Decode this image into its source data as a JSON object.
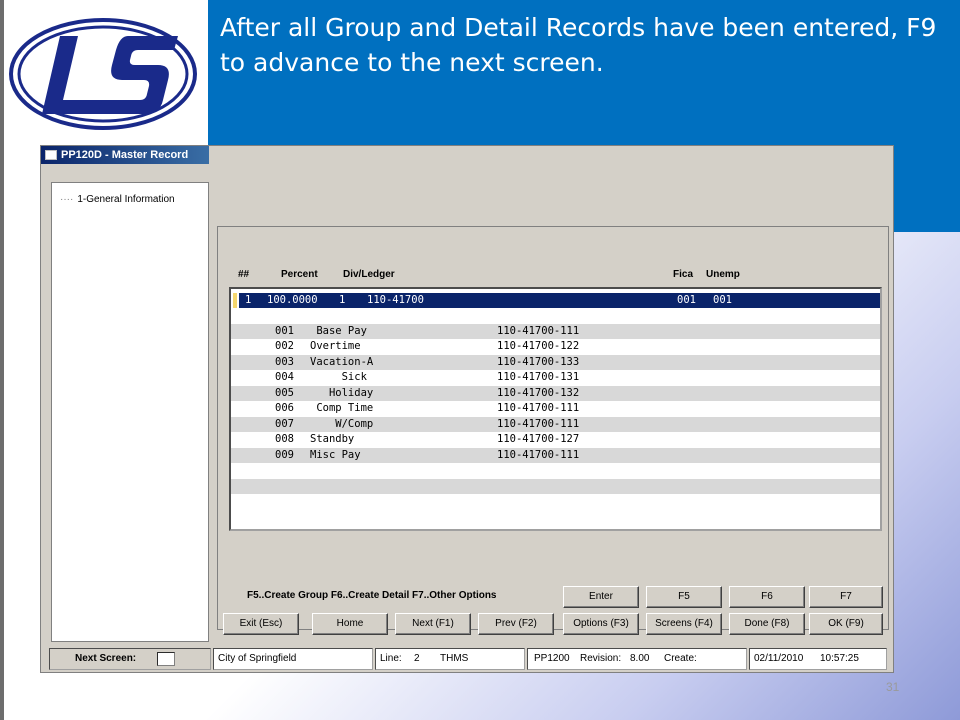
{
  "callout": {
    "text": "After all Group and Detail Records have been entered, F9 to advance to the next screen."
  },
  "window": {
    "title": "PP120D - Master Record"
  },
  "tree": {
    "items": [
      {
        "label": "1-General Information"
      }
    ]
  },
  "grid": {
    "headers": {
      "num": "##",
      "percent": "Percent",
      "divledger": "Div/Ledger",
      "fica": "Fica",
      "unemp": "Unemp"
    },
    "group_row": {
      "num": "1",
      "percent": "100.0000",
      "div": "1",
      "ledger": "110-41700",
      "fica": "001",
      "unemp": "001"
    },
    "detail_rows": [
      {
        "code": "001",
        "desc": " Base Pay",
        "account": "110-41700-111"
      },
      {
        "code": "002",
        "desc": "Overtime",
        "account": "110-41700-122"
      },
      {
        "code": "003",
        "desc": "Vacation-A",
        "account": "110-41700-133"
      },
      {
        "code": "004",
        "desc": "     Sick",
        "account": "110-41700-131"
      },
      {
        "code": "005",
        "desc": "   Holiday",
        "account": "110-41700-132"
      },
      {
        "code": "006",
        "desc": " Comp Time",
        "account": "110-41700-111"
      },
      {
        "code": "007",
        "desc": "    W/Comp",
        "account": "110-41700-111"
      },
      {
        "code": "008",
        "desc": "Standby",
        "account": "110-41700-127"
      },
      {
        "code": "009",
        "desc": "Misc Pay",
        "account": "110-41700-111"
      }
    ]
  },
  "fkeys_hint": "F5..Create Group  F6..Create Detail  F7..Other Options",
  "buttons": {
    "enter": "Enter",
    "f5": "F5",
    "f6": "F6",
    "f7": "F7",
    "exit": "Exit (Esc)",
    "home": "Home",
    "next": "Next (F1)",
    "prev": "Prev (F2)",
    "options": "Options (F3)",
    "screens": "Screens (F4)",
    "done": "Done (F8)",
    "ok": "OK (F9)"
  },
  "status": {
    "next_screen_label": "Next Screen:",
    "entity": "City of Springfield",
    "line_label": "Line:",
    "line_value": "2",
    "user": "THMS",
    "program": "PP1200",
    "revision_label": "Revision:",
    "revision_value": "8.00",
    "create_label": "Create:",
    "date": "02/11/2010",
    "time": "10:57:25"
  },
  "slide": {
    "page_number": "31"
  },
  "colors": {
    "callout_bg": "#0070c0",
    "logo_blue": "#1a2a8a",
    "selection": "#0a246a"
  }
}
